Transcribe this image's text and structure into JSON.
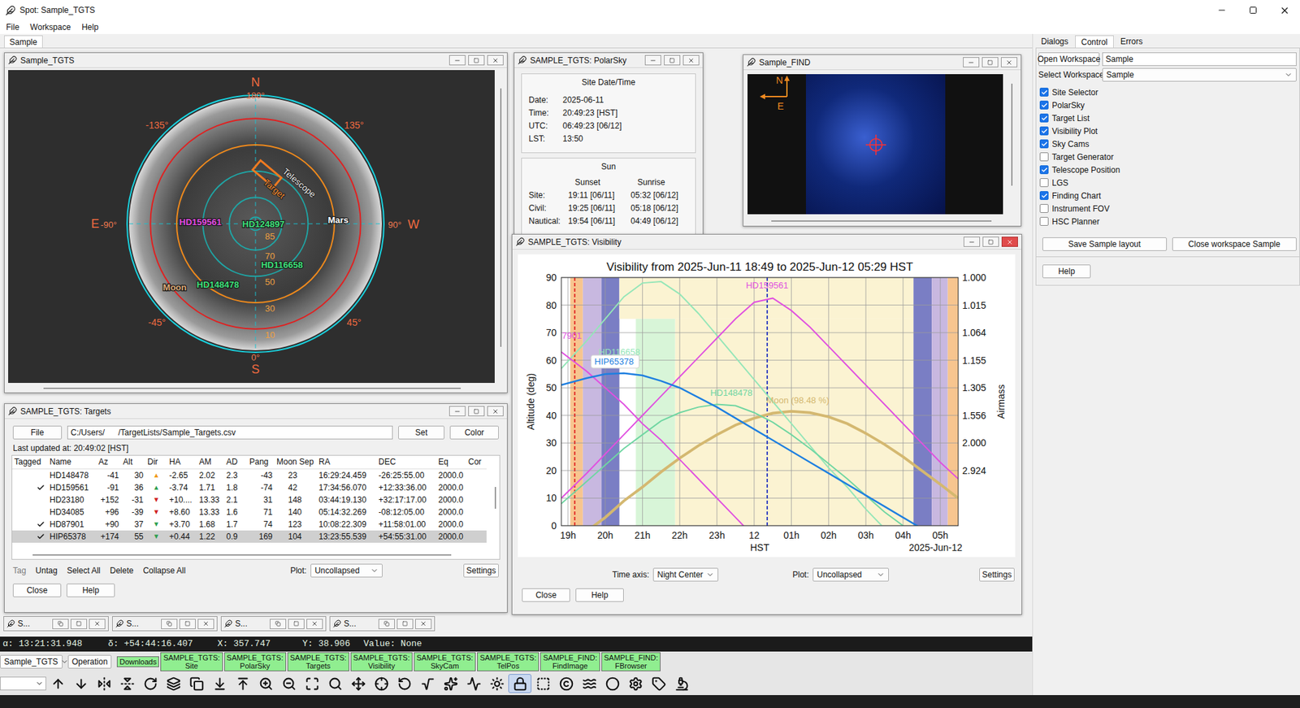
{
  "window": {
    "title": "Spot: Sample_TGTS"
  },
  "menu": [
    "File",
    "Workspace",
    "Help"
  ],
  "workspace_tab": {
    "label": "Sample",
    "selected": true
  },
  "sky_window": {
    "title": "Sample_TGTS",
    "active": false,
    "compass": {
      "north": "N",
      "north_deg": "180°",
      "south": "S",
      "south_deg": "0°",
      "east": "E",
      "east_deg": "-90°",
      "west": "W",
      "west_deg": "90°"
    },
    "diagonals": [
      {
        "label": "-135°",
        "az": -135
      },
      {
        "label": "135°",
        "az": 135
      },
      {
        "label": "-45°",
        "az": -45
      },
      {
        "label": "45°",
        "az": 45
      }
    ],
    "rings": [
      {
        "label": "85",
        "color": "#1fa5a5"
      },
      {
        "label": "70",
        "color": "#1fa5a5"
      },
      {
        "label": "50",
        "color": "#1fa5a5"
      },
      {
        "label": "30",
        "color": "#f08a1c"
      },
      {
        "label": "10",
        "color": "#e02020"
      }
    ],
    "targets": [
      {
        "name": "HD159561",
        "color": "#e44ce4",
        "az": -92,
        "alt": 48
      },
      {
        "name": "HD124897",
        "color": "#3ee07a",
        "az": 90,
        "alt": 84
      },
      {
        "name": "Mars",
        "color": "#ffffff",
        "az": 93,
        "alt": 27
      },
      {
        "name": "HD116658",
        "color": "#3ee07a",
        "az": 33,
        "alt": 53
      },
      {
        "name": "HD148478",
        "color": "#3ee07a",
        "az": -32,
        "alt": 36
      },
      {
        "name": "Moon",
        "color": "#d9a877",
        "az": -52,
        "alt": 12
      }
    ],
    "telescope": {
      "label": "Telescope",
      "target_label": "Target",
      "az": 167,
      "alt": 51
    }
  },
  "polarsky": {
    "title": "SAMPLE_TGTS: PolarSky",
    "active": false,
    "site_box": {
      "title": "Site Date/Time",
      "rows": [
        {
          "label": "Date:",
          "value": "2025-06-11"
        },
        {
          "label": "Time:",
          "value": "20:49:23 [HST]"
        },
        {
          "label": "UTC:",
          "value": "06:49:23 [06/12]"
        },
        {
          "label": "LST:",
          "value": "13:50"
        }
      ]
    },
    "sun_box": {
      "title": "Sun",
      "columns": [
        "Sunset",
        "Sunrise"
      ],
      "rows": [
        {
          "label": "Site:",
          "sunset": "19:11 [06/11]",
          "sunrise": "05:32 [06/12]"
        },
        {
          "label": "Civil:",
          "sunset": "19:25 [06/11]",
          "sunrise": "05:18 [06/12]"
        },
        {
          "label": "Nautical:",
          "sunset": "19:54 [06/11]",
          "sunrise": "04:49 [06/12]"
        }
      ]
    }
  },
  "find": {
    "title": "Sample_FIND",
    "active": false,
    "north": "N",
    "east": "E"
  },
  "visibility": {
    "title": "SAMPLE_TGTS: Visibility",
    "active": true,
    "chart_title": "Visibility from 2025-Jun-11 18:49 to 2025-Jun-12 05:29 HST",
    "y_label": "Altitude (deg)",
    "y2_label": "Airmass",
    "x_label": "HST",
    "x_date": "2025-Jun-12",
    "y_ticks": [
      "0",
      "10",
      "20",
      "30",
      "40",
      "50",
      "60",
      "70",
      "80",
      "90"
    ],
    "airmass_ticks": [
      "1.000",
      "1.015",
      "1.064",
      "1.155",
      "1.305",
      "1.556",
      "2.000",
      "2.924"
    ],
    "x_ticks": [
      {
        "label": "19h",
        "hour": 19
      },
      {
        "label": "20h",
        "hour": 20
      },
      {
        "label": "21h",
        "hour": 21
      },
      {
        "label": "22h",
        "hour": 22
      },
      {
        "label": "23h",
        "hour": 23
      },
      {
        "label": "12",
        "hour": 24
      },
      {
        "label": "01h",
        "hour": 25
      },
      {
        "label": "02h",
        "hour": 26
      },
      {
        "label": "03h",
        "hour": 27
      },
      {
        "label": "04h",
        "hour": 28
      },
      {
        "label": "05h",
        "hour": 29
      }
    ],
    "bands": [
      {
        "start": 19.06,
        "end": 19.4,
        "min": 0,
        "max": 90,
        "color": "#f7c58f"
      },
      {
        "start": 19.4,
        "end": 19.9,
        "min": 0,
        "max": 90,
        "color": "#c8b8e0"
      },
      {
        "start": 19.9,
        "end": 20.38,
        "min": 0,
        "max": 90,
        "color": "#7a7ec4"
      },
      {
        "start": 20.38,
        "end": 28.28,
        "min": 75,
        "max": 90,
        "color": "#fbf3d2"
      },
      {
        "start": 20.82,
        "end": 21.88,
        "min": 0,
        "max": 75,
        "color": "#d8f5d8"
      },
      {
        "start": 21.88,
        "end": 28.28,
        "min": 0,
        "max": 75,
        "color": "#fbf3d2"
      },
      {
        "start": 28.28,
        "end": 28.77,
        "min": 0,
        "max": 90,
        "color": "#7a7ec4"
      },
      {
        "start": 28.77,
        "end": 29.2,
        "min": 0,
        "max": 90,
        "color": "#c8b8e0"
      },
      {
        "start": 29.2,
        "end": 29.48,
        "min": 0,
        "max": 90,
        "color": "#f7c58f"
      }
    ],
    "markers": [
      {
        "hour": 19.18,
        "color": "#e02020"
      },
      {
        "hour": 24.35,
        "color": "#1f2fc0"
      }
    ],
    "times": [
      18.82,
      19.5,
      20,
      20.5,
      21,
      21.5,
      22,
      22.5,
      23,
      23.5,
      24,
      24.5,
      25,
      25.5,
      26,
      26.5,
      27,
      27.5,
      28,
      28.5,
      29,
      29.48
    ],
    "series": [
      {
        "name": "Moon",
        "color": "#d4b870",
        "width": 4,
        "values": [
          -8,
          -2,
          3,
          9,
          14,
          19.5,
          24.5,
          29,
          33,
          36.5,
          39,
          40.8,
          41.5,
          41,
          39.5,
          37,
          33.5,
          29.5,
          25,
          20,
          15,
          10
        ],
        "label": {
          "text": "Moon (98.48 %)",
          "hour": 24.33,
          "alt": 44.3,
          "boxed": false
        }
      },
      {
        "name": "HD116658",
        "color": "#94e6b8",
        "width": 2,
        "values": [
          57,
          67,
          75,
          83,
          88,
          88.5,
          84,
          77,
          69,
          61,
          53,
          45,
          37,
          29,
          21,
          14,
          6,
          -1,
          -8,
          -15,
          -22,
          -28
        ],
        "label": {
          "text": "HD116658",
          "hour": 19.82,
          "alt": 62,
          "boxed": false
        }
      },
      {
        "name": "HD148478",
        "color": "#6fd6a2",
        "width": 2,
        "values": [
          8,
          16,
          22,
          28,
          33,
          38,
          41,
          43,
          44,
          43.5,
          41,
          37.5,
          33,
          28,
          22.5,
          17,
          11,
          5,
          0,
          -5,
          -10,
          -15
        ],
        "label": {
          "text": "HD148478",
          "hour": 22.82,
          "alt": 47,
          "boxed": false
        }
      },
      {
        "name": "HD87901",
        "color": "#e050e0",
        "width": 2,
        "values": [
          63,
          56,
          50,
          44,
          37,
          31,
          24,
          17,
          10,
          3,
          -4,
          -11,
          -18,
          -25,
          -32,
          -39,
          -46,
          -53,
          -60,
          -67,
          -74,
          -80
        ],
        "label": {
          "text": "7901",
          "hour": 18.84,
          "alt": 67.8,
          "boxed": false
        }
      },
      {
        "name": "HD159561",
        "color": "#e050e0",
        "width": 2,
        "values": [
          10,
          19,
          26,
          33,
          40,
          47,
          54,
          61,
          68,
          75,
          81,
          82.5,
          78,
          72,
          65,
          58,
          51,
          44,
          37,
          30,
          23,
          17
        ],
        "label": {
          "text": "HD159561",
          "hour": 23.78,
          "alt": 86,
          "boxed": false
        }
      },
      {
        "name": "HIP65378",
        "color": "#1e7fe0",
        "width": 2.5,
        "values": [
          51,
          53.5,
          55,
          55.3,
          54.5,
          52.5,
          50,
          46.5,
          43,
          39,
          35,
          31,
          27,
          23,
          19,
          15,
          11,
          7,
          3,
          -1,
          -5,
          -9
        ],
        "label": {
          "text": "HIP65378",
          "hour": 19.71,
          "alt": 58.4,
          "boxed": true
        }
      }
    ],
    "time_axis_label": "Time axis:",
    "time_axis_value": "Night Center",
    "plot_label": "Plot:",
    "plot_value": "Uncollapsed",
    "settings": "Settings",
    "buttons": [
      "Close",
      "Help"
    ]
  },
  "targets": {
    "title": "SAMPLE_TGTS: Targets",
    "active": false,
    "file_button": "File",
    "path": "C:/Users/      /TargetLists/Sample_Targets.csv",
    "set_button": "Set",
    "color_button": "Color",
    "last_updated": "Last updated at: 20:49:02 [HST]",
    "columns": [
      "Tagged",
      "Name",
      "Az",
      "Alt",
      "Dir",
      "HA",
      "AM",
      "AD",
      "Pang",
      "Moon Sep",
      "RA",
      "DEC",
      "Eq",
      "Cor"
    ],
    "rows": [
      {
        "tagged": false,
        "selected": false,
        "name": "HD148478",
        "az": "-41",
        "alt": "30",
        "dir": "▲",
        "dir_color": "#f09a1a",
        "ha": "-2.65",
        "am": "2.02",
        "ad": "2.3",
        "pang": "-43",
        "moon_sep": "23",
        "ra": "16:29:24.459",
        "dec": "-26:25:55.00",
        "eq": "2000.0"
      },
      {
        "tagged": true,
        "selected": false,
        "name": "HD159561",
        "az": "-91",
        "alt": "36",
        "dir": "▲",
        "dir_color": "#2e9e4f",
        "ha": "-3.74",
        "am": "1.71",
        "ad": "1.8",
        "pang": "-74",
        "moon_sep": "42",
        "ra": "17:34:56.070",
        "dec": "+12:33:36.00",
        "eq": "2000.0"
      },
      {
        "tagged": false,
        "selected": false,
        "name": "HD23180",
        "az": "+152",
        "alt": "-31",
        "dir": "▼",
        "dir_color": "#d02020",
        "ha": "+10....",
        "am": "13.33",
        "ad": "2.1",
        "pang": "31",
        "moon_sep": "148",
        "ra": "03:44:19.130",
        "dec": "+32:17:17.00",
        "eq": "2000.0"
      },
      {
        "tagged": false,
        "selected": false,
        "name": "HD34085",
        "az": "+96",
        "alt": "-39",
        "dir": "▼",
        "dir_color": "#d02020",
        "ha": "+8.60",
        "am": "13.33",
        "ad": "1.6",
        "pang": "71",
        "moon_sep": "140",
        "ra": "05:14:32.269",
        "dec": "-08:12:05.00",
        "eq": "2000.0"
      },
      {
        "tagged": true,
        "selected": false,
        "name": "HD87901",
        "az": "+90",
        "alt": "37",
        "dir": "▼",
        "dir_color": "#2e9e4f",
        "ha": "+3.70",
        "am": "1.68",
        "ad": "1.7",
        "pang": "74",
        "moon_sep": "123",
        "ra": "10:08:22.309",
        "dec": "+11:58:01.00",
        "eq": "2000.0"
      },
      {
        "tagged": true,
        "selected": true,
        "name": "HIP65378",
        "az": "+174",
        "alt": "55",
        "dir": "▼",
        "dir_color": "#2e9e4f",
        "ha": "+0.44",
        "am": "1.22",
        "ad": "0.9",
        "pang": "169",
        "moon_sep": "104",
        "ra": "13:23:55.539",
        "dec": "+54:55:31.00",
        "eq": "2000.0"
      }
    ],
    "actions": [
      {
        "label": "Tag",
        "disabled": true
      },
      {
        "label": "Untag",
        "disabled": false
      },
      {
        "label": "Select All",
        "disabled": false
      },
      {
        "label": "Delete",
        "disabled": false
      },
      {
        "label": "Collapse All",
        "disabled": false
      }
    ],
    "plot_label": "Plot:",
    "plot_value": "Uncollapsed",
    "settings": "Settings",
    "buttons": [
      "Close",
      "Help"
    ]
  },
  "minimized": [
    {
      "label": "S..."
    },
    {
      "label": "S..."
    },
    {
      "label": "S..."
    },
    {
      "label": "S..."
    }
  ],
  "status_bar": {
    "ra": "α: 13:21:31.948",
    "dec": "δ: +54:44:16.407",
    "x": "X: 357.747",
    "y": "Y: 38.906",
    "value": "Value: None"
  },
  "channels": {
    "selected": "Sample_TGTS",
    "operation": "Operation",
    "buttons": [
      {
        "lines": [
          "Downloads"
        ]
      },
      {
        "lines": [
          "SAMPLE_TGTS:",
          "Site"
        ]
      },
      {
        "lines": [
          "SAMPLE_TGTS:",
          "PolarSky"
        ]
      },
      {
        "lines": [
          "SAMPLE_TGTS:",
          "Targets"
        ]
      },
      {
        "lines": [
          "SAMPLE_TGTS:",
          "Visibility"
        ]
      },
      {
        "lines": [
          "SAMPLE_TGTS:",
          "SkyCam"
        ]
      },
      {
        "lines": [
          "SAMPLE_TGTS:",
          "TelPos"
        ]
      },
      {
        "lines": [
          "SAMPLE_FIND:",
          "FindImage"
        ]
      },
      {
        "lines": [
          "SAMPLE_FIND:",
          "FBrowser"
        ]
      }
    ]
  },
  "toolbar": [
    {
      "selected": false
    },
    {
      "selected": false
    },
    {
      "selected": false
    },
    {
      "selected": false
    },
    {
      "selected": false
    },
    {
      "selected": false
    },
    {
      "selected": false
    },
    {
      "selected": false
    },
    {
      "selected": false
    },
    {
      "selected": false
    },
    {
      "selected": false
    },
    {
      "selected": false
    },
    {
      "selected": false
    },
    {
      "selected": false
    },
    {
      "selected": false
    },
    {
      "selected": false
    },
    {
      "selected": false
    },
    {
      "selected": false
    },
    {
      "selected": false
    },
    {
      "selected": false
    },
    {
      "selected": true
    },
    {
      "selected": false
    },
    {
      "selected": false
    },
    {
      "selected": false
    },
    {
      "selected": false
    },
    {
      "selected": false
    },
    {
      "selected": false
    },
    {
      "selected": false
    }
  ],
  "right_panel": {
    "tabs": [
      {
        "label": "Dialogs",
        "selected": false
      },
      {
        "label": "Control",
        "selected": true
      },
      {
        "label": "Errors",
        "selected": false
      }
    ],
    "open_workspace": "Open Workspace",
    "open_workspace_value": "Sample",
    "select_workspace": "Select Workspace:",
    "select_workspace_value": "Sample",
    "plugins": [
      {
        "label": "Site Selector",
        "checked": true
      },
      {
        "label": "PolarSky",
        "checked": true
      },
      {
        "label": "Target List",
        "checked": true
      },
      {
        "label": "Visibility Plot",
        "checked": true
      },
      {
        "label": "Sky Cams",
        "checked": true
      },
      {
        "label": "Target Generator",
        "checked": false
      },
      {
        "label": "Telescope Position",
        "checked": true
      },
      {
        "label": "LGS",
        "checked": false
      },
      {
        "label": "Finding Chart",
        "checked": true
      },
      {
        "label": "Instrument FOV",
        "checked": false
      },
      {
        "label": "HSC Planner",
        "checked": false
      }
    ],
    "save_button": "Save Sample layout",
    "close_button": "Close workspace Sample",
    "help_button": "Help"
  }
}
